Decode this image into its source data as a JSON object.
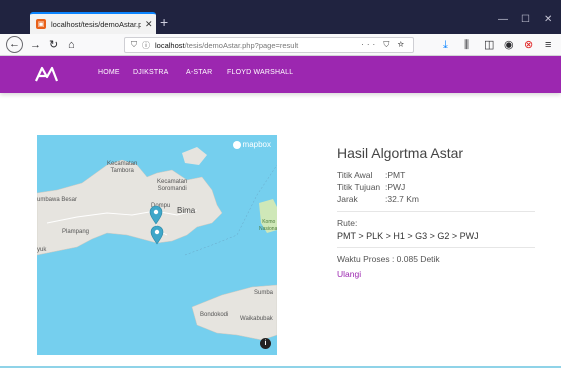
{
  "browser": {
    "tab_title": "localhost/tesis/demoAstar.php",
    "new_tab_symbol": "+",
    "url_host": "localhost",
    "url_rest": "/tesis/demoAstar.php?page=result",
    "url_actions": "··· ⛉ ☆",
    "toolbar_icons": [
      "download-icon",
      "library-icon",
      "sidebar-icon",
      "account-icon",
      "adblock-icon",
      "menu-icon"
    ]
  },
  "site": {
    "menu": [
      "HOME",
      "DJIKSTRA",
      "A-STAR",
      "FLOYD WARSHALL"
    ],
    "brand_color": "#9c27b0"
  },
  "map": {
    "attribution": "mapbox",
    "labels": {
      "kecamatan_tambora": "Kecamatan\nTambora",
      "kecamatan_soromandi": "Kecamatan\nSoromandi",
      "sumbawa_besar": "umbawa Besar",
      "dompu": "Dompu",
      "bima": "Bima",
      "plampang": "Plampang",
      "nyuk": "yuk",
      "komodo": "Komo\nNasional",
      "sumba": "Sumba",
      "bondokodi": "Bondokodi",
      "waikabubak": "Waikabubak"
    },
    "info_symbol": "i"
  },
  "result": {
    "title": "Hasil Algortma Astar",
    "titik_awal_label": "Titik Awal",
    "titik_awal_value": ":PMT",
    "titik_tujuan_label": "Titik Tujuan",
    "titik_tujuan_value": ":PWJ",
    "jarak_label": "Jarak",
    "jarak_value": ":32.7 Km",
    "rute_label": "Rute:",
    "rute_value": "PMT > PLK > H1 > G3 > G2 > PWJ",
    "waktu_proses": "Waktu Proses : 0.085 Detik",
    "ulangi": "Ulangi"
  }
}
